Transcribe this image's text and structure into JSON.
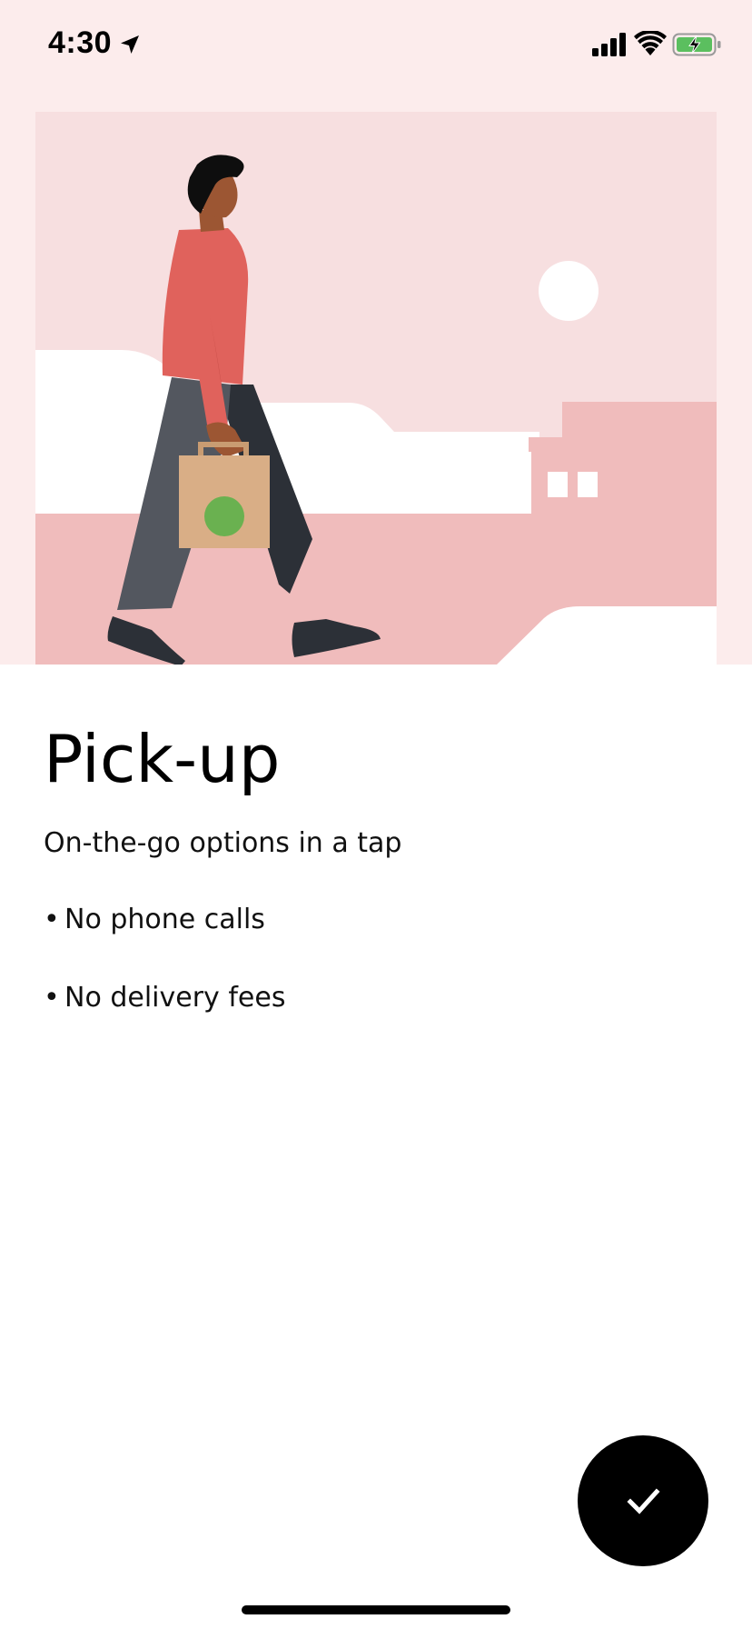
{
  "status_bar": {
    "time": "4:30",
    "location_icon": "location-arrow-icon",
    "signal_icon": "cellular-signal-icon",
    "wifi_icon": "wifi-icon",
    "battery_icon": "battery-charging-icon",
    "battery_color": "#5bbf5f"
  },
  "illustration": {
    "subject": "person-carrying-pickup-bag",
    "colors": {
      "band_background": "#fcecec",
      "sky": "#f7dfe0",
      "ground": "#f0bcbc",
      "shirt": "#e0625c",
      "pants": "#53575f",
      "bag": "#d9ae86",
      "bag_logo": "#6ab150"
    }
  },
  "content": {
    "title": "Pick-up",
    "subtitle": "On-the-go options in a tap",
    "features": [
      "No phone calls",
      "No delivery fees"
    ],
    "bullet": "•"
  },
  "confirm_button": {
    "icon": "checkmark-icon",
    "color": "#000000"
  }
}
